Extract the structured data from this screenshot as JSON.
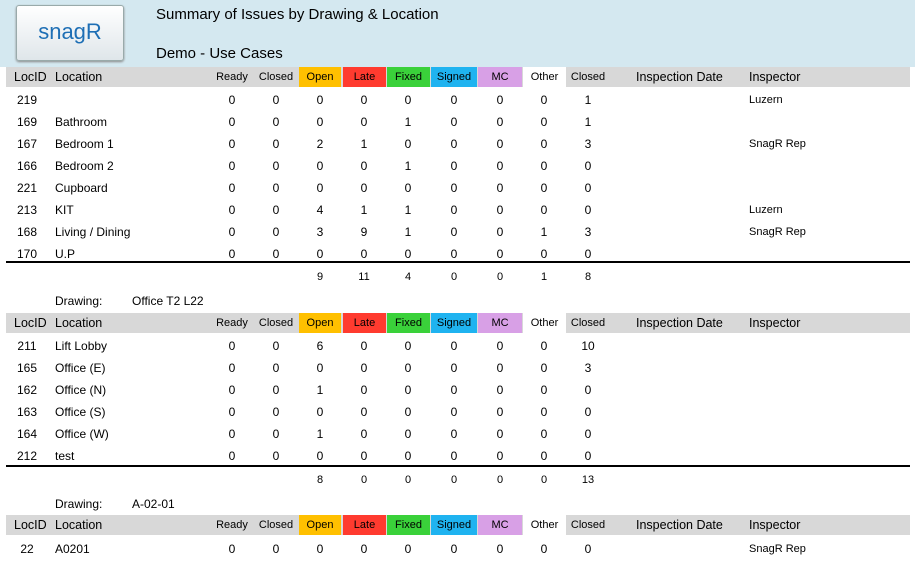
{
  "logo_text": "snagR",
  "report": {
    "title": "Summary of Issues by Drawing & Location",
    "subtitle": "Demo - Use Cases"
  },
  "columns": {
    "locid": "LocID",
    "location": "Location",
    "ready": "Ready",
    "closed": "Closed",
    "open": "Open",
    "late": "Late",
    "fixed": "Fixed",
    "signed": "Signed",
    "mc": "MC",
    "other": "Other",
    "closed2": "Closed",
    "inspection_date": "Inspection Date",
    "inspector": "Inspector"
  },
  "colors": {
    "open": "#ffc000",
    "late": "#ff3b2f",
    "fixed": "#3ad13a",
    "signed": "#1fb3f0",
    "mc": "#d8a0e6",
    "other": "#ffffff",
    "header_bg": "#d8d8d8",
    "banner_bg": "#d4e8f0"
  },
  "sections": [
    {
      "drawing_label": "",
      "drawing_value": "",
      "rows": [
        {
          "locid": "219",
          "location": "",
          "ready": "0",
          "closed": "0",
          "open": "0",
          "late": "0",
          "fixed": "0",
          "signed": "0",
          "mc": "0",
          "other": "0",
          "closed2": "1",
          "inspection_date": "",
          "inspector": "Luzern"
        },
        {
          "locid": "169",
          "location": "Bathroom",
          "ready": "0",
          "closed": "0",
          "open": "0",
          "late": "0",
          "fixed": "1",
          "signed": "0",
          "mc": "0",
          "other": "0",
          "closed2": "1",
          "inspection_date": "",
          "inspector": ""
        },
        {
          "locid": "167",
          "location": "Bedroom 1",
          "ready": "0",
          "closed": "0",
          "open": "2",
          "late": "1",
          "fixed": "0",
          "signed": "0",
          "mc": "0",
          "other": "0",
          "closed2": "3",
          "inspection_date": "",
          "inspector": "SnagR Rep"
        },
        {
          "locid": "166",
          "location": "Bedroom 2",
          "ready": "0",
          "closed": "0",
          "open": "0",
          "late": "0",
          "fixed": "1",
          "signed": "0",
          "mc": "0",
          "other": "0",
          "closed2": "0",
          "inspection_date": "",
          "inspector": ""
        },
        {
          "locid": "221",
          "location": "Cupboard",
          "ready": "0",
          "closed": "0",
          "open": "0",
          "late": "0",
          "fixed": "0",
          "signed": "0",
          "mc": "0",
          "other": "0",
          "closed2": "0",
          "inspection_date": "",
          "inspector": ""
        },
        {
          "locid": "213",
          "location": "KIT",
          "ready": "0",
          "closed": "0",
          "open": "4",
          "late": "1",
          "fixed": "1",
          "signed": "0",
          "mc": "0",
          "other": "0",
          "closed2": "0",
          "inspection_date": "",
          "inspector": "Luzern"
        },
        {
          "locid": "168",
          "location": "Living / Dining",
          "ready": "0",
          "closed": "0",
          "open": "3",
          "late": "9",
          "fixed": "1",
          "signed": "0",
          "mc": "0",
          "other": "1",
          "closed2": "3",
          "inspection_date": "",
          "inspector": "SnagR Rep"
        },
        {
          "locid": "170",
          "location": "U.P",
          "ready": "0",
          "closed": "0",
          "open": "0",
          "late": "0",
          "fixed": "0",
          "signed": "0",
          "mc": "0",
          "other": "0",
          "closed2": "0",
          "inspection_date": "",
          "inspector": ""
        }
      ],
      "totals": {
        "open": "9",
        "late": "11",
        "fixed": "4",
        "signed": "0",
        "mc": "0",
        "other": "1",
        "closed2": "8"
      }
    },
    {
      "drawing_label": "Drawing:",
      "drawing_value": "Office T2 L22",
      "rows": [
        {
          "locid": "211",
          "location": "Lift Lobby",
          "ready": "0",
          "closed": "0",
          "open": "6",
          "late": "0",
          "fixed": "0",
          "signed": "0",
          "mc": "0",
          "other": "0",
          "closed2": "10",
          "inspection_date": "",
          "inspector": ""
        },
        {
          "locid": "165",
          "location": "Office (E)",
          "ready": "0",
          "closed": "0",
          "open": "0",
          "late": "0",
          "fixed": "0",
          "signed": "0",
          "mc": "0",
          "other": "0",
          "closed2": "3",
          "inspection_date": "",
          "inspector": ""
        },
        {
          "locid": "162",
          "location": "Office (N)",
          "ready": "0",
          "closed": "0",
          "open": "1",
          "late": "0",
          "fixed": "0",
          "signed": "0",
          "mc": "0",
          "other": "0",
          "closed2": "0",
          "inspection_date": "",
          "inspector": ""
        },
        {
          "locid": "163",
          "location": "Office (S)",
          "ready": "0",
          "closed": "0",
          "open": "0",
          "late": "0",
          "fixed": "0",
          "signed": "0",
          "mc": "0",
          "other": "0",
          "closed2": "0",
          "inspection_date": "",
          "inspector": ""
        },
        {
          "locid": "164",
          "location": "Office (W)",
          "ready": "0",
          "closed": "0",
          "open": "1",
          "late": "0",
          "fixed": "0",
          "signed": "0",
          "mc": "0",
          "other": "0",
          "closed2": "0",
          "inspection_date": "",
          "inspector": ""
        },
        {
          "locid": "212",
          "location": "test",
          "ready": "0",
          "closed": "0",
          "open": "0",
          "late": "0",
          "fixed": "0",
          "signed": "0",
          "mc": "0",
          "other": "0",
          "closed2": "0",
          "inspection_date": "",
          "inspector": ""
        }
      ],
      "totals": {
        "open": "8",
        "late": "0",
        "fixed": "0",
        "signed": "0",
        "mc": "0",
        "other": "0",
        "closed2": "13"
      }
    },
    {
      "drawing_label": "Drawing:",
      "drawing_value": "A-02-01",
      "rows": [
        {
          "locid": "22",
          "location": "A0201",
          "ready": "0",
          "closed": "0",
          "open": "0",
          "late": "0",
          "fixed": "0",
          "signed": "0",
          "mc": "0",
          "other": "0",
          "closed2": "0",
          "inspection_date": "",
          "inspector": "SnagR Rep"
        }
      ],
      "totals": null
    }
  ]
}
